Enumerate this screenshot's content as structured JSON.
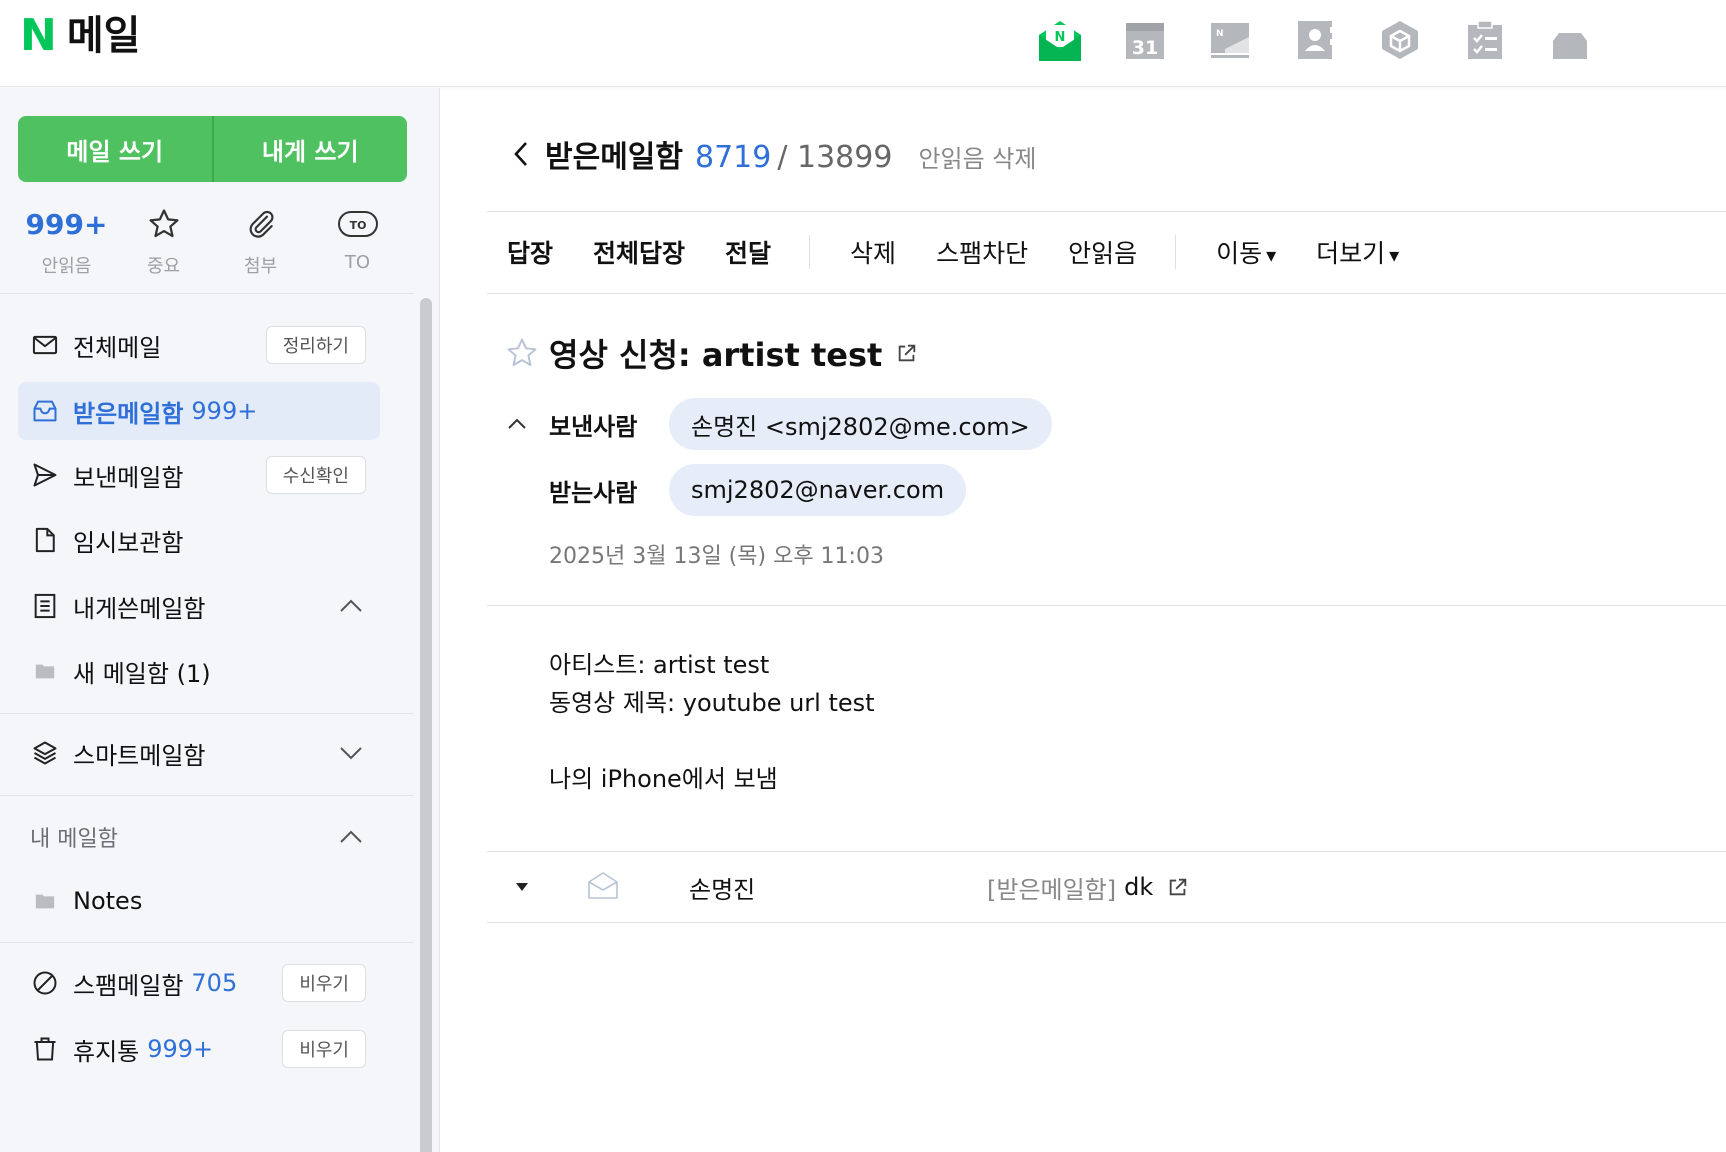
{
  "header": {
    "logo_letter": "N",
    "logo_text": "메일",
    "apps": [
      "mail-app-icon",
      "calendar-app-icon",
      "news-app-icon",
      "contacts-app-icon",
      "box-app-icon",
      "todo-app-icon",
      "more-app-icon"
    ],
    "calendar_day": "31",
    "brand_color": "#03c75a"
  },
  "sidebar": {
    "compose": "메일 쓰기",
    "compose_self": "내게 쓰기",
    "quick": {
      "unread_count": "999+",
      "unread_label": "안읽음",
      "important_label": "중요",
      "attach_label": "첨부",
      "to_badge": "TO",
      "to_label": "TO"
    },
    "folders": {
      "all": {
        "label": "전체메일",
        "action": "정리하기"
      },
      "inbox": {
        "label": "받은메일함",
        "count": "999+"
      },
      "sent": {
        "label": "보낸메일함",
        "action": "수신확인"
      },
      "drafts": {
        "label": "임시보관함"
      },
      "self": {
        "label": "내게쓴메일함"
      },
      "new_box": {
        "label": "새 메일함 (1)"
      },
      "smart": {
        "label": "스마트메일함"
      },
      "my_section": "내 메일함",
      "notes": {
        "label": "Notes"
      },
      "spam": {
        "label": "스팸메일함",
        "count": "705",
        "action": "비우기"
      },
      "trash": {
        "label": "휴지통",
        "count": "999+",
        "action": "비우기"
      }
    }
  },
  "main": {
    "folder_title": "받은메일함",
    "unread": "8719",
    "total": "/ 13899",
    "delete_unread": "안읽음 삭제",
    "toolbar": {
      "reply": "답장",
      "reply_all": "전체답장",
      "forward": "전달",
      "delete": "삭제",
      "spam_block": "스팸차단",
      "mark_unread": "안읽음",
      "move": "이동",
      "more": "더보기"
    },
    "subject": "영상 신청: artist test",
    "from_label": "보낸사람",
    "from_value": "손명진 <smj2802@me.com>",
    "to_label": "받는사람",
    "to_value": "smj2802@naver.com",
    "date": "2025년 3월 13일 (목) 오후 11:03",
    "body": {
      "line1": "아티스트: artist test",
      "line2": "동영상 제목: youtube url test",
      "line3": "나의 iPhone에서 보냄"
    },
    "thread": {
      "sender": "손명진",
      "folder": "[받은메일함]",
      "subject": "dk"
    }
  }
}
